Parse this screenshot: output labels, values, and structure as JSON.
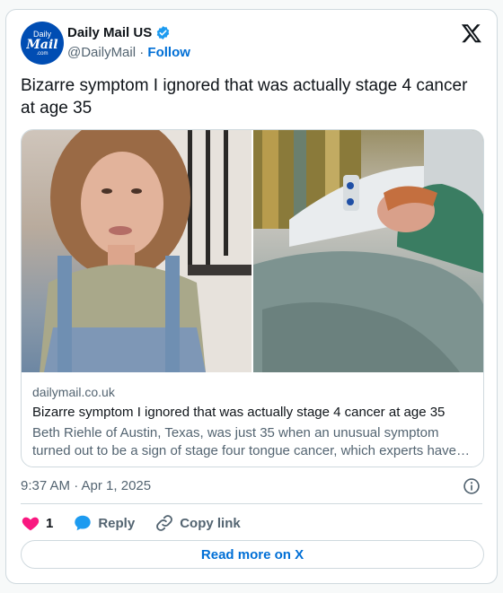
{
  "account": {
    "avatar_line1": "Daily",
    "avatar_line2": "Mail",
    "avatar_line3": ".com",
    "name": "Daily Mail US",
    "handle": "@DailyMail",
    "separator": "·",
    "follow_label": "Follow"
  },
  "tweet": {
    "text": "Bizarre symptom I ignored that was actually stage 4 cancer at age 35"
  },
  "link_card": {
    "domain": "dailymail.co.uk",
    "title": "Bizarre symptom I ignored that was actually stage 4 cancer at age 35",
    "description": "Beth Riehle of Austin, Texas, was just 35 when an unusual symptom turned out to be a sign of stage four tongue cancer, which experts have…"
  },
  "meta": {
    "timestamp": "9:37 AM · Apr 1, 2025"
  },
  "actions": {
    "like_count": "1",
    "reply_label": "Reply",
    "copy_label": "Copy link"
  },
  "footer": {
    "read_more_label": "Read more on X"
  },
  "colors": {
    "link_blue": "#006fd6",
    "like_pink": "#f91880",
    "reply_blue": "#1d9bf0",
    "muted": "#536471",
    "border": "#cfd9de"
  },
  "icons": [
    "verified-badge-icon",
    "x-logo-icon",
    "info-icon",
    "heart-icon",
    "reply-bubble-icon",
    "link-icon"
  ]
}
